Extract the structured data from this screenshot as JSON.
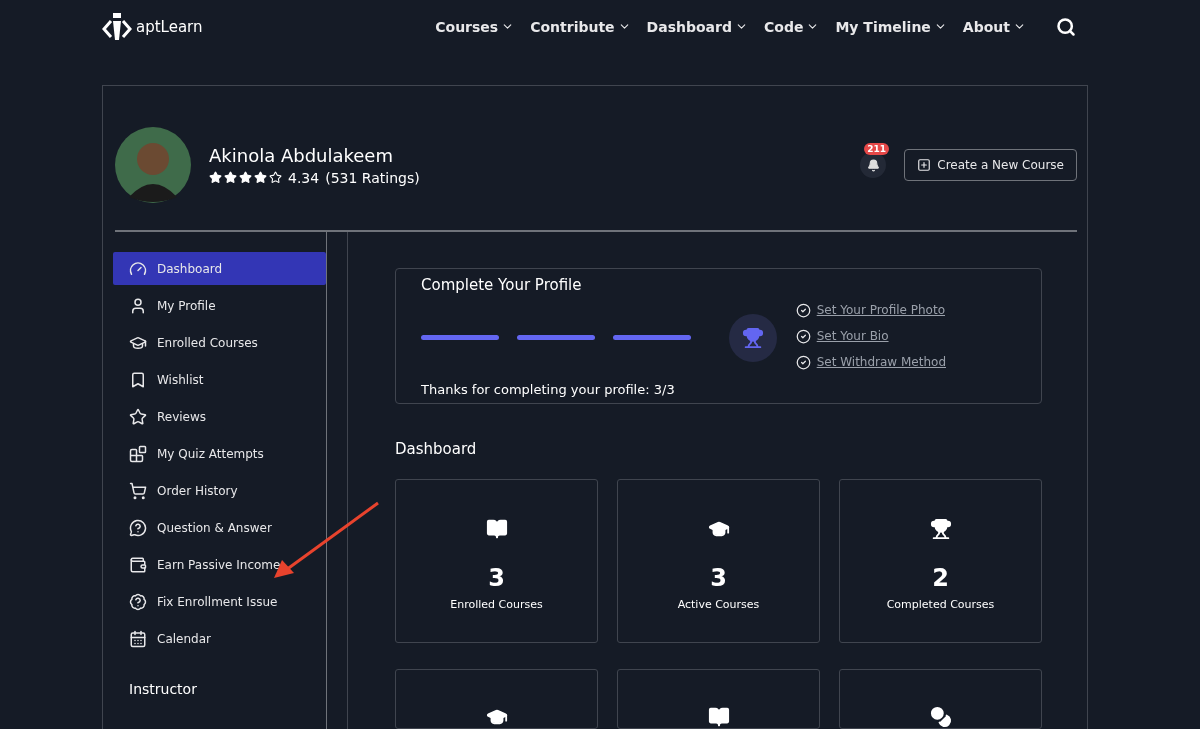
{
  "logo": {
    "text": "aptLearn"
  },
  "nav": [
    {
      "label": "Courses"
    },
    {
      "label": "Contribute"
    },
    {
      "label": "Dashboard"
    },
    {
      "label": "Code"
    },
    {
      "label": "My Timeline"
    },
    {
      "label": "About"
    }
  ],
  "profile": {
    "name": "Akinola Abdulakeem",
    "stars": 4,
    "rating": "4.34",
    "ratings_count": "(531 Ratings)",
    "notification_count": "211",
    "create_button": "Create a New Course"
  },
  "sidebar": {
    "items": [
      {
        "label": "Dashboard",
        "selected": true
      },
      {
        "label": "My Profile",
        "selected": false
      },
      {
        "label": "Enrolled Courses",
        "selected": false
      },
      {
        "label": "Wishlist",
        "selected": false
      },
      {
        "label": "Reviews",
        "selected": false
      },
      {
        "label": "My Quiz Attempts",
        "selected": false
      },
      {
        "label": "Order History",
        "selected": false
      },
      {
        "label": "Question & Answer",
        "selected": false
      },
      {
        "label": "Earn Passive Income",
        "selected": false
      },
      {
        "label": "Fix Enrollment Issue",
        "selected": false
      },
      {
        "label": "Calendar",
        "selected": false
      }
    ],
    "section_heading": "Instructor"
  },
  "complete_profile": {
    "title": "Complete Your Profile",
    "steps": [
      {
        "done": true
      },
      {
        "done": true
      },
      {
        "done": true
      }
    ],
    "message": "Thanks for completing your profile: 3/3",
    "checklist": [
      {
        "label": "Set Your Profile Photo",
        "checked": true
      },
      {
        "label": "Set Your Bio",
        "checked": true
      },
      {
        "label": "Set Withdraw Method",
        "checked": true
      }
    ]
  },
  "dashboard": {
    "title": "Dashboard",
    "cards": [
      {
        "value": "3",
        "label": "Enrolled Courses"
      },
      {
        "value": "3",
        "label": "Active Courses"
      },
      {
        "value": "2",
        "label": "Completed Courses"
      }
    ]
  }
}
